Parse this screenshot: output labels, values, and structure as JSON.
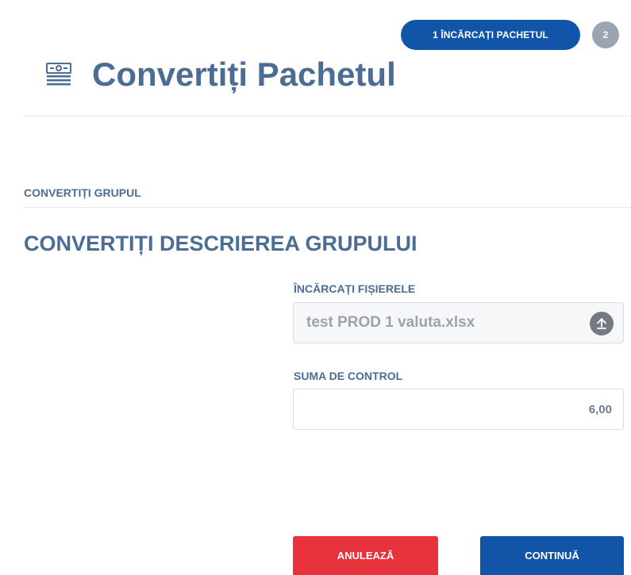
{
  "steps": {
    "active_label": "1 ÎNCĂRCAȚI PACHETUL",
    "inactive_label": "2"
  },
  "header": {
    "title": "Convertiți Pachetul",
    "icon": "money-document-icon"
  },
  "section": {
    "label": "CONVERTIȚI GRUPUL",
    "heading": "CONVERTIȚI DESCRIEREA GRUPULUI"
  },
  "form": {
    "file_label": "ÎNCĂRCAȚI FIȘIERELE",
    "file_value": "test PROD 1 valuta.xlsx",
    "upload_icon": "upload-arrow-icon",
    "checksum_label": "SUMA DE CONTROL",
    "checksum_value": "6,00"
  },
  "actions": {
    "cancel_label": "ANULEAZĂ",
    "continue_label": "CONTINUĂ"
  },
  "colors": {
    "primary": "#1155a8",
    "danger": "#e8323c",
    "heading": "#4b6d93",
    "step_inactive": "#9aa5b1"
  }
}
